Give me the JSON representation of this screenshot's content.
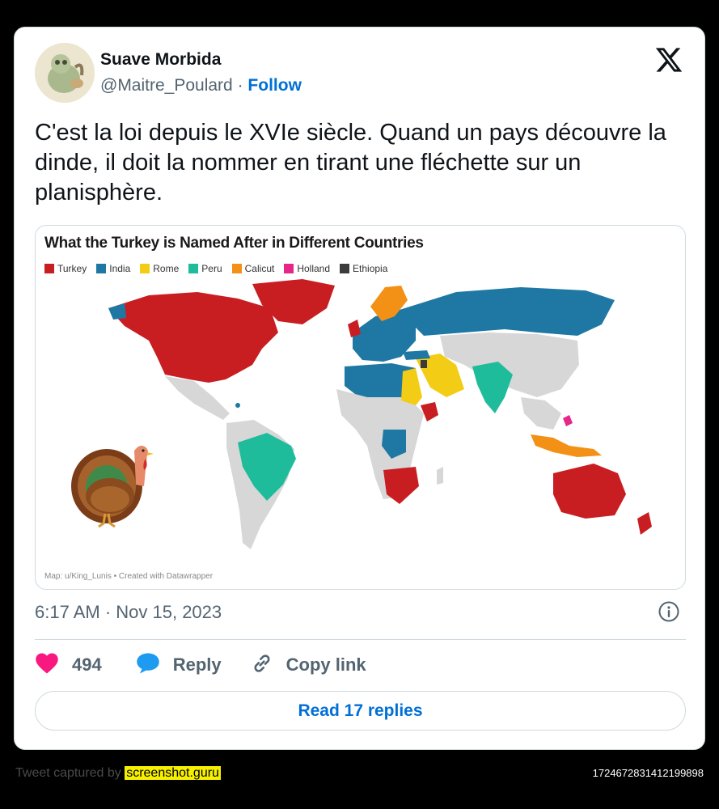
{
  "tweet": {
    "author_name": "Suave Morbida",
    "handle": "@Maitre_Poulard",
    "separator": "·",
    "follow_label": "Follow",
    "text": "C'est la loi depuis le XVIe siècle. Quand un pays découvre la dinde, il doit la nommer en tirant une fléchette sur un planisphère.",
    "timestamp": "6:17 AM · Nov 15, 2023",
    "likes_count": "494",
    "reply_label": "Reply",
    "copy_link_label": "Copy link",
    "read_replies_label": "Read 17 replies"
  },
  "media": {
    "title": "What the Turkey is Named After in Different Countries",
    "legend": [
      {
        "label": "Turkey",
        "color": "#c81e21"
      },
      {
        "label": "India",
        "color": "#1f78a4"
      },
      {
        "label": "Rome",
        "color": "#f3cc15"
      },
      {
        "label": "Peru",
        "color": "#1fbc9c"
      },
      {
        "label": "Calicut",
        "color": "#f39117"
      },
      {
        "label": "Holland",
        "color": "#e6278a"
      },
      {
        "label": "Ethiopia",
        "color": "#3b3b3b"
      }
    ],
    "source": "Map: u/King_Lunis • Created with Datawrapper"
  },
  "footer": {
    "captured_prefix": "Tweet captured by",
    "captured_link": "screenshot.guru",
    "tweet_id": "1724672831412199898"
  },
  "colors": {
    "follow_blue": "#006fd6",
    "like_pink": "#f91880",
    "reply_blue": "#1d9bf0",
    "no_data_gray": "#d7d7d7"
  }
}
